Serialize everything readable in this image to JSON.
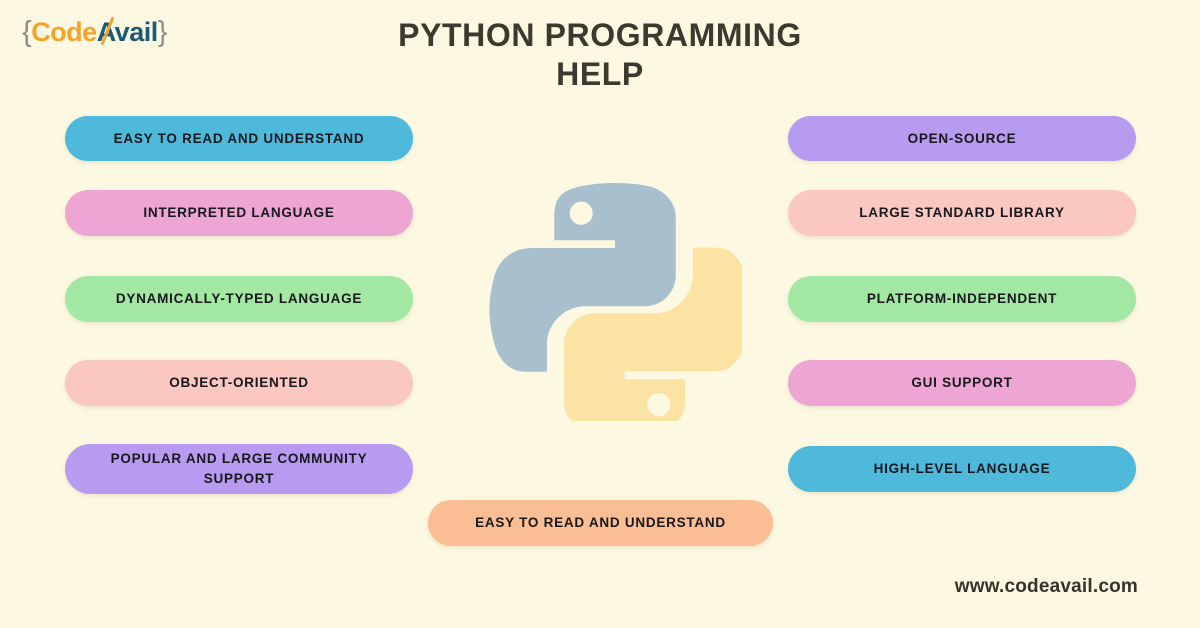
{
  "background_color": "#FDF8E1",
  "logo": {
    "open_brace": "{",
    "part_one": "Code",
    "part_two": "Avail",
    "close_brace": "}",
    "color_part_one": "#F5A42A",
    "color_part_two": "#1C5B74",
    "color_braces": "#8C8C8C"
  },
  "header": {
    "title_line_1": "PYTHON PROGRAMMING",
    "title_line_2": "HELP",
    "title_color": "#3A3A2E"
  },
  "features": {
    "left_column": [
      {
        "label": "EASY TO READ AND UNDERSTAND",
        "color": "#4FB9DC"
      },
      {
        "label": "INTERPRETED LANGUAGE",
        "color": "#EDA6D4"
      },
      {
        "label": "DYNAMICALLY-TYPED LANGUAGE",
        "color": "#A2E8A3"
      },
      {
        "label": "OBJECT-ORIENTED",
        "color": "#FBC8C1"
      },
      {
        "label": "POPULAR AND LARGE COMMUNITY SUPPORT",
        "color": "#B79BF0"
      }
    ],
    "right_column": [
      {
        "label": "OPEN-SOURCE",
        "color": "#B79BF0"
      },
      {
        "label": "LARGE STANDARD LIBRARY",
        "color": "#FBC8C1"
      },
      {
        "label": "PLATFORM-INDEPENDENT",
        "color": "#A2E8A3"
      },
      {
        "label": "GUI SUPPORT",
        "color": "#EDA6D4"
      },
      {
        "label": "HIGH-LEVEL LANGUAGE",
        "color": "#4FB9DC"
      }
    ],
    "bottom_center": {
      "label": "EASY TO READ AND UNDERSTAND",
      "color": "#FBBE94"
    }
  },
  "python_logo": {
    "name": "python-logo",
    "color_upper": "#A8BFCE",
    "color_lower": "#FBE3A4"
  },
  "footer": {
    "website": "www.codeavail.com"
  }
}
